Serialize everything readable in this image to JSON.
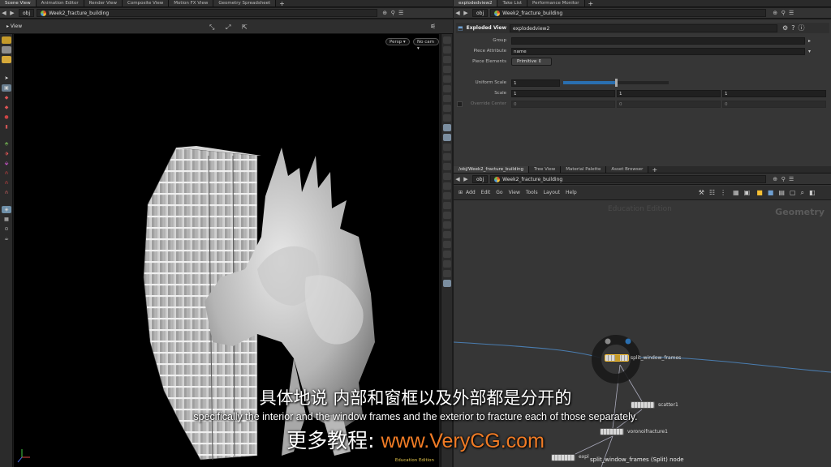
{
  "left_tabs": [
    "Scene View",
    "Animation Editor",
    "Render View",
    "Composite View",
    "Motion FX View",
    "Geometry Spreadsheet"
  ],
  "left_path": {
    "back": "◀",
    "fwd": "▶",
    "context": "obj",
    "network": "Week2_fracture_building"
  },
  "viewport": {
    "title": "View",
    "persp_btn": "Persp ▾",
    "cam_btn": "No cam ▾",
    "edition": "Education Edition"
  },
  "right_top_tabs": [
    "explodedview2",
    "Take List",
    "Performance Monitor"
  ],
  "right_top_path": {
    "context": "obj",
    "network": "Week2_fracture_building"
  },
  "param_header": {
    "node_type": "Exploded View",
    "node_name": "explodedview2"
  },
  "params": {
    "group_label": "Group",
    "piece_attr_label": "Piece Attribute",
    "piece_attr_value": "name",
    "piece_elem_label": "Piece Elements",
    "piece_elem_value": "Primitive",
    "uniform_scale_label": "Uniform Scale",
    "uniform_scale_value": "1",
    "uniform_scale_fraction": 0.5,
    "scale_label": "Scale",
    "scale_x": "1",
    "scale_y": "1",
    "scale_z": "1",
    "override_center_label": "Override Center",
    "oc_x": "0",
    "oc_y": "0",
    "oc_z": "0"
  },
  "net_tabs": [
    "/obj/Week2_fracture_building",
    "Tree View",
    "Material Palette",
    "Asset Browser"
  ],
  "net_path": {
    "context": "obj",
    "network": "Week2_fracture_building"
  },
  "net_menu": [
    "Add",
    "Edit",
    "Go",
    "View",
    "Tools",
    "Layout",
    "Help"
  ],
  "net_overlay": {
    "edition": "Education Edition",
    "context": "Geometry"
  },
  "nodes": [
    {
      "label": "split_window_frames"
    },
    {
      "label": "scatter1"
    },
    {
      "label": "voronoifracture1"
    },
    {
      "label": "expl"
    }
  ],
  "node_tooltip": "split_window_frames (Split) node",
  "subtitles": {
    "zh": "具体地说 内部和窗框以及外部都是分开的",
    "en": "specifically the interior and the window frames and the exterior to fracture each of those separately.",
    "wm_prefix": "更多教程: ",
    "wm_url": "www.VeryCG.com"
  },
  "colors": {
    "accent_orange": "#f07b25",
    "selection_blue": "#2a6fb0",
    "panel_bg": "#363636"
  }
}
